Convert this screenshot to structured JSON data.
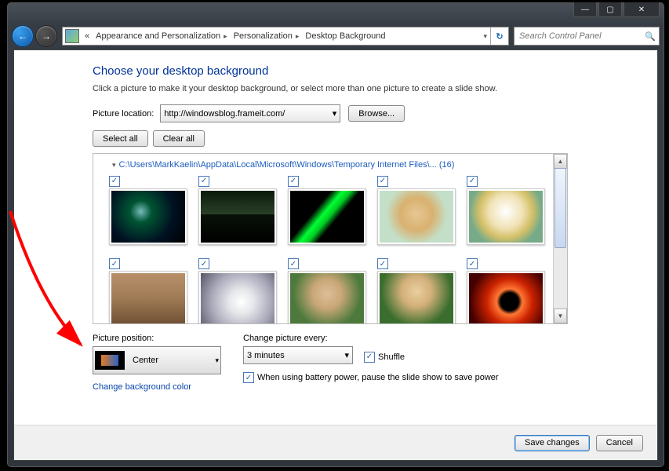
{
  "window": {
    "minimize": "—",
    "maximize": "▢",
    "close": "✕"
  },
  "nav": {
    "back": "←",
    "forward": "→",
    "crumb_prefix": "«",
    "crumbs": [
      "Appearance and Personalization",
      "Personalization",
      "Desktop Background"
    ],
    "refresh": "↻"
  },
  "search": {
    "placeholder": "Search Control Panel"
  },
  "page": {
    "title": "Choose your desktop background",
    "subtitle": "Click a picture to make it your desktop background, or select more than one picture to create a slide show.",
    "picture_location_label": "Picture location:",
    "picture_location_value": "http://windowsblog.frameit.com/",
    "browse": "Browse...",
    "select_all": "Select all",
    "clear_all": "Clear all",
    "group_header": "C:\\Users\\MarkKaelin\\AppData\\Local\\Microsoft\\Windows\\Temporary Internet Files\\... (16)",
    "position_label": "Picture position:",
    "position_value": "Center",
    "change_every_label": "Change picture every:",
    "change_every_value": "3 minutes",
    "shuffle": "Shuffle",
    "battery": "When using battery power, pause the slide show to save power",
    "change_bg_color": "Change background color"
  },
  "thumbs": [
    {
      "check": "✓",
      "art": "t-space"
    },
    {
      "check": "✓",
      "art": "t-lake"
    },
    {
      "check": "✓",
      "art": "t-aurora"
    },
    {
      "check": "✓",
      "art": "t-dog1"
    },
    {
      "check": "✓",
      "art": "t-dog2"
    },
    {
      "check": "✓",
      "art": "t-mars"
    },
    {
      "check": "✓",
      "art": "t-storm"
    },
    {
      "check": "✓",
      "art": "t-puppy1"
    },
    {
      "check": "✓",
      "art": "t-puppy2"
    },
    {
      "check": "✓",
      "art": "t-sun"
    }
  ],
  "footer": {
    "save": "Save changes",
    "cancel": "Cancel"
  }
}
